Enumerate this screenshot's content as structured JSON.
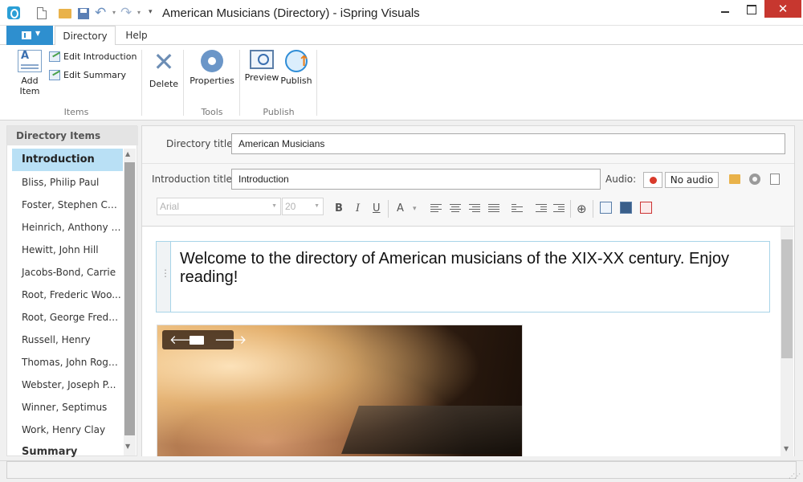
{
  "window": {
    "title": "American Musicians (Directory) - iSpring Visuals",
    "close_glyph": "✕"
  },
  "quick_access": {
    "undo_glyph": "↶",
    "redo_glyph": "↷",
    "menu_glyph": "▾"
  },
  "ribbon": {
    "tabs": [
      "Directory",
      "Help"
    ],
    "active_tab": "Directory",
    "file_caret": "▼",
    "groups": {
      "items": {
        "label": "Items",
        "add_item": "Add Item",
        "edit_introduction": "Edit Introduction",
        "edit_summary": "Edit Summary"
      },
      "tools": {
        "label": "Tools",
        "delete": "Delete",
        "delete_glyph": "✕",
        "properties": "Properties"
      },
      "publish": {
        "label": "Publish",
        "preview": "Preview",
        "publish": "Publish"
      }
    }
  },
  "sidebar": {
    "header": "Directory Items",
    "items": [
      {
        "label": "Introduction",
        "selected": true
      },
      {
        "label": "Bliss, Philip Paul"
      },
      {
        "label": "Foster, Stephen Col..."
      },
      {
        "label": "Heinrich, Anthony P..."
      },
      {
        "label": "Hewitt, John Hill"
      },
      {
        "label": "Jacobs-Bond, Carrie"
      },
      {
        "label": "Root, Frederic Woo..."
      },
      {
        "label": "Root, George Frede..."
      },
      {
        "label": "Russell, Henry"
      },
      {
        "label": "Thomas, John Rogers"
      },
      {
        "label": "Webster, Joseph P..."
      },
      {
        "label": "Winner, Septimus"
      },
      {
        "label": "Work, Henry Clay"
      },
      {
        "label": "Summary",
        "bold": true
      }
    ],
    "scroll_up": "▲",
    "scroll_down": "▼"
  },
  "form": {
    "directory_title_label": "Directory title:",
    "directory_title_value": "American Musicians",
    "intro_title_label": "Introduction title:",
    "intro_title_value": "Introduction",
    "audio_label": "Audio:",
    "audio_value": "No audio"
  },
  "format_toolbar": {
    "font": "Arial",
    "size": "20",
    "dropdown_glyph": "▼",
    "bold": "B",
    "italic": "I",
    "underline": "U",
    "font_color": "A",
    "color_caret": "▾",
    "link_glyph": "⊕"
  },
  "editor": {
    "intro_text": "Welcome to the directory of American musicians of the XIX-XX century. Enjoy reading!",
    "image_prev_glyph": "🡐",
    "image_next_glyph": "🡒",
    "scroll_down": "▼"
  },
  "statusbar": {
    "grip": "⋰⋰"
  }
}
